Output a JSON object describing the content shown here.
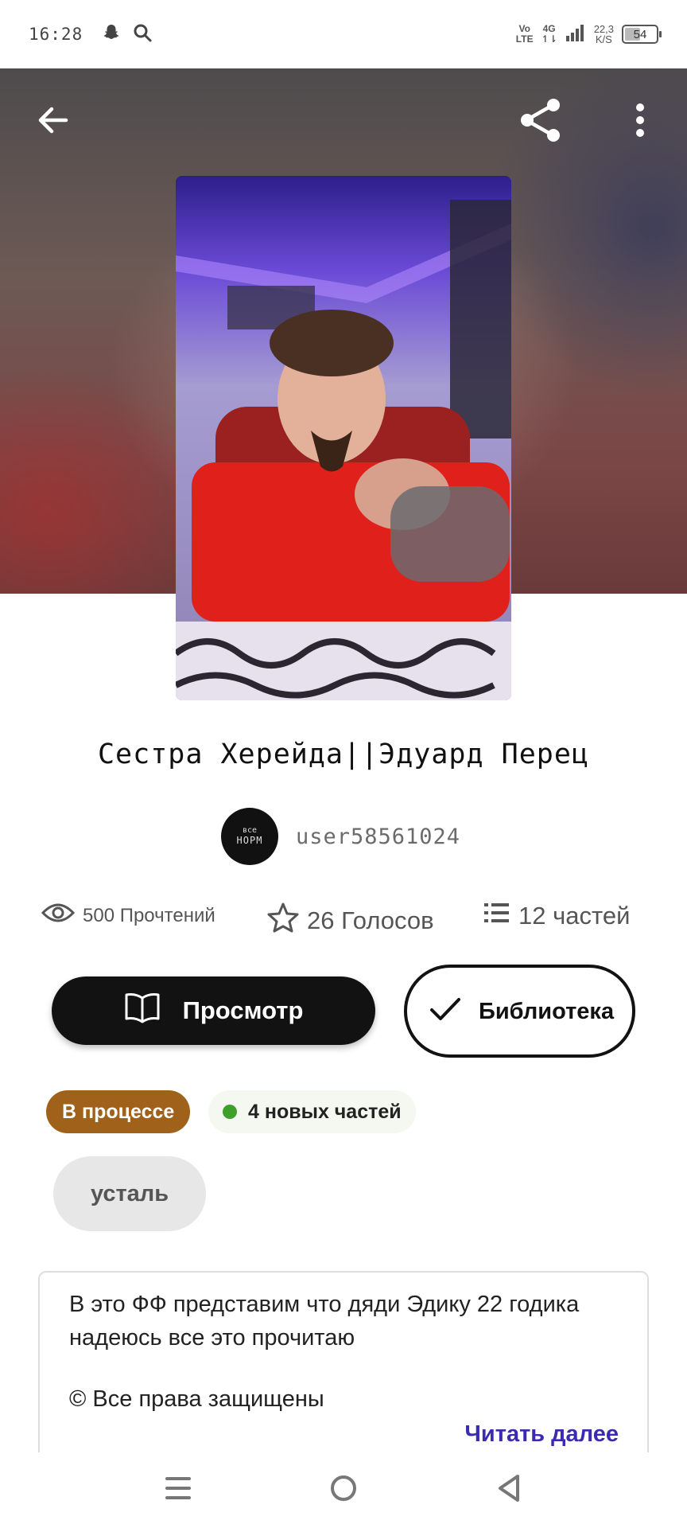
{
  "status_bar": {
    "time": "16:28",
    "net_top": "Vo",
    "net_bottom": "LTE",
    "net_type": "4G",
    "speed_top": "22,3",
    "speed_bottom": "K/S",
    "battery_level": "54",
    "battery_fraction": 0.54
  },
  "header": {
    "back_icon": "arrow-left-icon",
    "share_icon": "share-icon",
    "more_icon": "more-vertical-icon"
  },
  "story": {
    "title": "Сестра Херейда||Эдуард Перец",
    "author": {
      "name": "user58561024",
      "avatar_line1": "все",
      "avatar_line2": "НОРМ"
    },
    "stats": {
      "reads": "500 Прочтений",
      "votes": "26 Голосов",
      "parts": "12 частей"
    },
    "actions": {
      "view_label": "Просмотр",
      "library_label": "Библиотека"
    },
    "tags": {
      "status": "В процессе",
      "new_parts": "4 новых частей",
      "mood": "усталь"
    },
    "description": {
      "text": "В это ФФ представим что дяди Эдику 22 годика\nнадеюсь все это прочитаю",
      "copyright": "© Все права защищены",
      "read_more": "Читать далее"
    }
  },
  "nav": {
    "menu_icon": "menu-icon",
    "home_icon": "home-circle-icon",
    "back_icon": "triangle-back-icon"
  },
  "colors": {
    "status_tag": "#a0621a",
    "dot_green": "#3ea02a",
    "read_more": "#3a2bb0",
    "primary_button": "#121212"
  }
}
